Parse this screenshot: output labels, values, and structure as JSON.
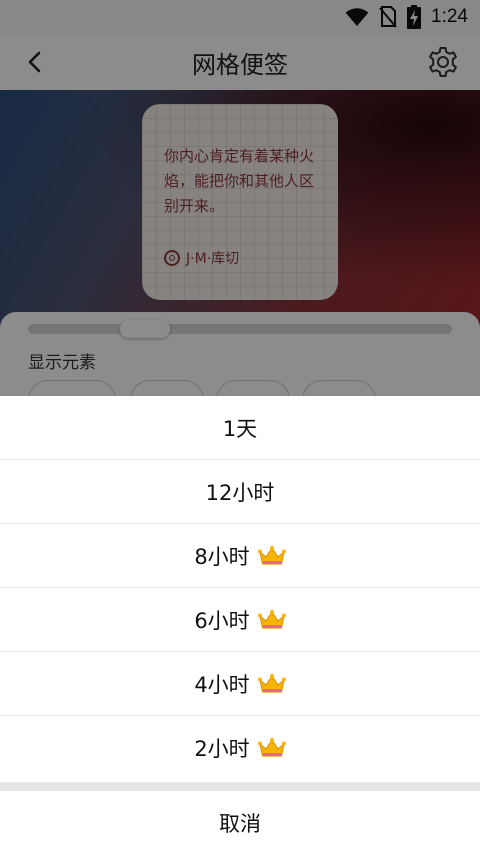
{
  "status_bar": {
    "time": "1:24",
    "icons": [
      "wifi-icon",
      "no-sim-icon",
      "battery-charging-icon"
    ]
  },
  "app_bar": {
    "title": "网格便签",
    "back_icon": "back-arrow-icon",
    "settings_icon": "gear-icon"
  },
  "preview": {
    "note_text": "你内心肯定有着某种火焰，能把你和其他人区别开来。",
    "author": "J·M·库切",
    "author_icon": "quote-source-icon"
  },
  "settings_panel": {
    "section_label": "显示元素"
  },
  "interval_sheet": {
    "options": [
      {
        "label": "1天",
        "premium": false
      },
      {
        "label": "12小时",
        "premium": false
      },
      {
        "label": "8小时",
        "premium": true
      },
      {
        "label": "6小时",
        "premium": true
      },
      {
        "label": "4小时",
        "premium": true
      },
      {
        "label": "2小时",
        "premium": true
      }
    ],
    "premium_icon": "crown-icon",
    "cancel_label": "取消"
  },
  "colors": {
    "note_text": "#8e3a3a",
    "crown": "#f5b400",
    "hero_start": "#2c4c7e",
    "hero_end": "#a0282f"
  }
}
